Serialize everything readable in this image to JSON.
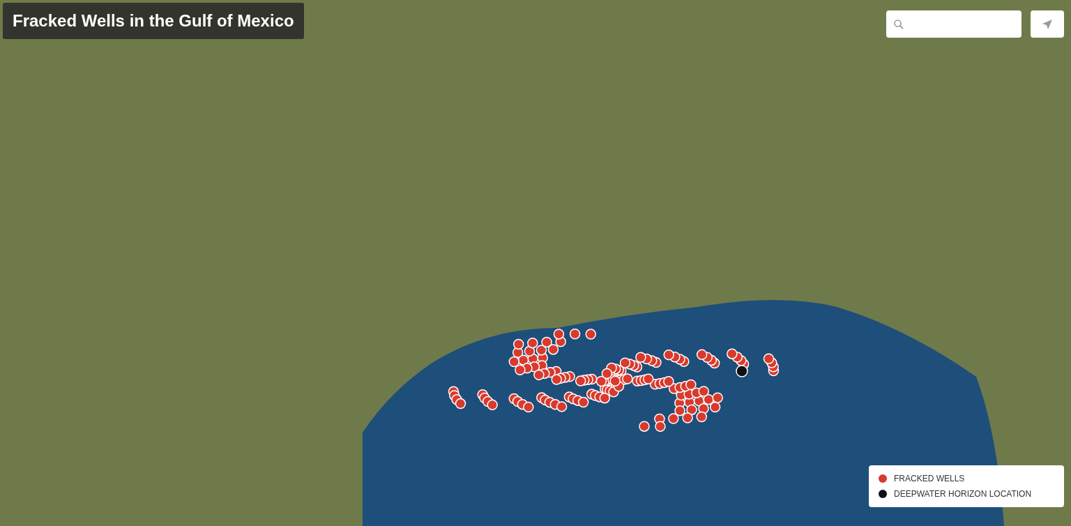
{
  "title": "Fracked Wells in the Gulf of Mexico",
  "legend": [
    {
      "label": "FRACKED WELLS",
      "color": "#d93a2e"
    },
    {
      "label": "DEEPWATER HORIZON LOCATION",
      "color": "#111111"
    }
  ]
}
